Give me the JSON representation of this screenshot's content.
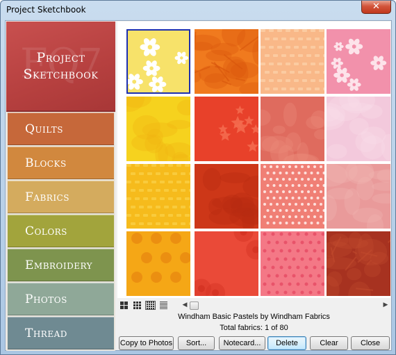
{
  "window": {
    "title": "Project Sketchbook",
    "close_glyph": "✕"
  },
  "brand": {
    "title": "Project\nSketchbook",
    "watermark": "EQ7"
  },
  "sidebar": {
    "items": [
      {
        "label": "Quilts",
        "color": "#c6683a"
      },
      {
        "label": "Blocks",
        "color": "#d1883e"
      },
      {
        "label": "Fabrics",
        "color": "#d4ab5e"
      },
      {
        "label": "Colors",
        "color": "#a2a43c"
      },
      {
        "label": "Embroidery",
        "color": "#7e944e"
      },
      {
        "label": "Photos",
        "color": "#8fa898"
      },
      {
        "label": "Thread",
        "color": "#6f8a92"
      }
    ]
  },
  "fabrics": [
    {
      "name": "yellow-daisy",
      "base": "#f7e26a",
      "accent": "#ffffff",
      "pattern": "flowers"
    },
    {
      "name": "orange-crackle",
      "base": "#f07a1e",
      "accent": "#d9560c",
      "pattern": "crackle"
    },
    {
      "name": "peach-weave",
      "base": "#f9b888",
      "accent": "#fcd3ac",
      "pattern": "weave"
    },
    {
      "name": "pink-floral",
      "base": "#f291ab",
      "accent": "#fde3ea",
      "pattern": "flowers"
    },
    {
      "name": "yellow-mottle",
      "base": "#f6d21e",
      "accent": "#f0b410",
      "pattern": "mottle"
    },
    {
      "name": "red-stars",
      "base": "#e8412a",
      "accent": "#f46a4e",
      "pattern": "stars"
    },
    {
      "name": "salmon-mottle",
      "base": "#df6b5e",
      "accent": "#ea8b7c",
      "pattern": "mottle"
    },
    {
      "name": "light-pink-mottle",
      "base": "#f3c9dc",
      "accent": "#f8dde9",
      "pattern": "mottle"
    },
    {
      "name": "gold-texture",
      "base": "#f6bb1c",
      "accent": "#fbd24a",
      "pattern": "weave"
    },
    {
      "name": "deep-red",
      "base": "#cd3718",
      "accent": "#b82c10",
      "pattern": "mottle"
    },
    {
      "name": "coral-dots",
      "base": "#f07f75",
      "accent": "#fde0dc",
      "pattern": "dots"
    },
    {
      "name": "dusty-pink",
      "base": "#e99a9a",
      "accent": "#f1b5b3",
      "pattern": "mottle"
    },
    {
      "name": "orange-polka",
      "base": "#f5a716",
      "accent": "#e88a10",
      "pattern": "bigdots"
    },
    {
      "name": "red-burst",
      "base": "#ea4a38",
      "accent": "#d63424",
      "pattern": "burst"
    },
    {
      "name": "pink-dots",
      "base": "#f47886",
      "accent": "#e8536a",
      "pattern": "smalldots"
    },
    {
      "name": "rust-texture",
      "base": "#a73220",
      "accent": "#c14a2d",
      "pattern": "crackle"
    }
  ],
  "info": {
    "collection": "Windham Basic Pastels by Windham Fabrics",
    "total": "Total fabrics: 1 of 80"
  },
  "scroll": {
    "left_glyph": "◀",
    "right_glyph": "▶"
  },
  "buttons": {
    "copy": "Copy to Photos",
    "sort": "Sort...",
    "notecard": "Notecard...",
    "delete": "Delete",
    "clear": "Clear",
    "close": "Close"
  }
}
